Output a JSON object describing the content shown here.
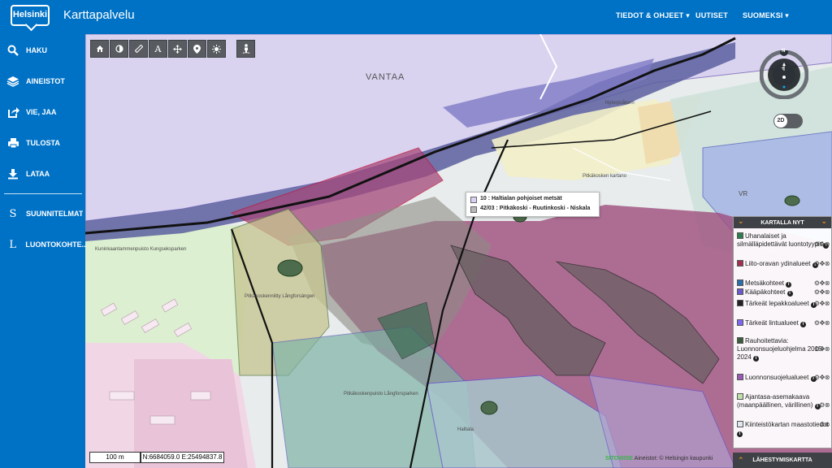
{
  "header": {
    "logo_text": "Helsinki",
    "title": "Karttapalvelu",
    "nav": [
      {
        "label": "TIEDOT & OHJEET ▾"
      },
      {
        "label": "UUTISET"
      },
      {
        "label": "SUOMEKSI ▾"
      }
    ]
  },
  "sidebar": {
    "items": [
      {
        "label": "HAKU",
        "icon": "search-icon"
      },
      {
        "label": "AINEISTOT",
        "icon": "layers-icon"
      },
      {
        "label": "VIE, JAA",
        "icon": "share-icon"
      },
      {
        "label": "TULOSTA",
        "icon": "print-icon"
      },
      {
        "label": "LATAA",
        "icon": "download-icon"
      },
      {
        "label": "SUUNNITELMAT",
        "icon": "plans-icon"
      },
      {
        "label": "LUONTOKOHTE...",
        "icon": "nature-icon"
      }
    ]
  },
  "toolbar": {
    "tools": [
      "home-icon",
      "contrast-icon",
      "ruler-icon",
      "text-icon",
      "move-icon",
      "location-pin-icon",
      "brightness-icon"
    ],
    "extra_tool": "person-icon"
  },
  "compass": {
    "north": "N"
  },
  "view_toggle": {
    "label": "2D"
  },
  "tooltip": {
    "rows": [
      {
        "text": "10 : Haltialan pohjoiset metsät",
        "color": "#d9d2f2"
      },
      {
        "text": "42/03 : Pitkäkoski - Ruutinkoski - Niskala",
        "color": "#b8b8b8"
      }
    ]
  },
  "panel": {
    "title": "KARTALLA NYT",
    "layers": [
      {
        "label": "Uhanalaiset ja silmälläpidettävät luontotyypit",
        "color": "#2e7d4f"
      },
      {
        "label": "Liito-oravan ydinalueet",
        "color": "#a03050"
      },
      {
        "label": "Metsäkohteet",
        "color": "#2b6ea8"
      },
      {
        "label": "Kääpäkohteet",
        "color": "#6a5acd"
      },
      {
        "label": "Tärkeät lepakkoalueet",
        "color": "#222222"
      },
      {
        "label": "Tärkeät lintualueet",
        "color": "#7b68ee"
      },
      {
        "label": "Rauhoitettavia: Luonnonsuojeluohjelma 2015-2024",
        "color": "#3c5a3c"
      },
      {
        "label": "Luonnonsuojelualueet",
        "color": "#9b59b6"
      },
      {
        "label": "Ajantasa-asemakaava (maanpäällinen, värillinen)",
        "color": "#bfe0a8"
      },
      {
        "label": "Kiinteistökartan maastotiedot",
        "color": "#dfe8f0"
      }
    ]
  },
  "nearby_map": {
    "label": "LÄHESTYMISKARTTA"
  },
  "scale": {
    "label": "100 m"
  },
  "coords": {
    "label": "N:6684059.0 E:25494837.8"
  },
  "attribution": {
    "brand": "SITOWISE",
    "text": "Aineistot: © Helsingin kaupunki"
  },
  "map_labels": {
    "vantaa": "VANTAA",
    "pitkakoski_kartano": "Pitkäkosken kartano",
    "vr": "VR",
    "nytorpsaker": "Nytorpsåkern",
    "kuninkaantammenpuisto": "Kuninkaantammenpuisto Kungseksparken",
    "pitkakoskenniitty": "Pitkäkoskenniitty Långforsängen",
    "pitkakoskenpuisto": "Pitkäkoskenpuisto Långforsparken",
    "haltiala": "Haltiala"
  }
}
